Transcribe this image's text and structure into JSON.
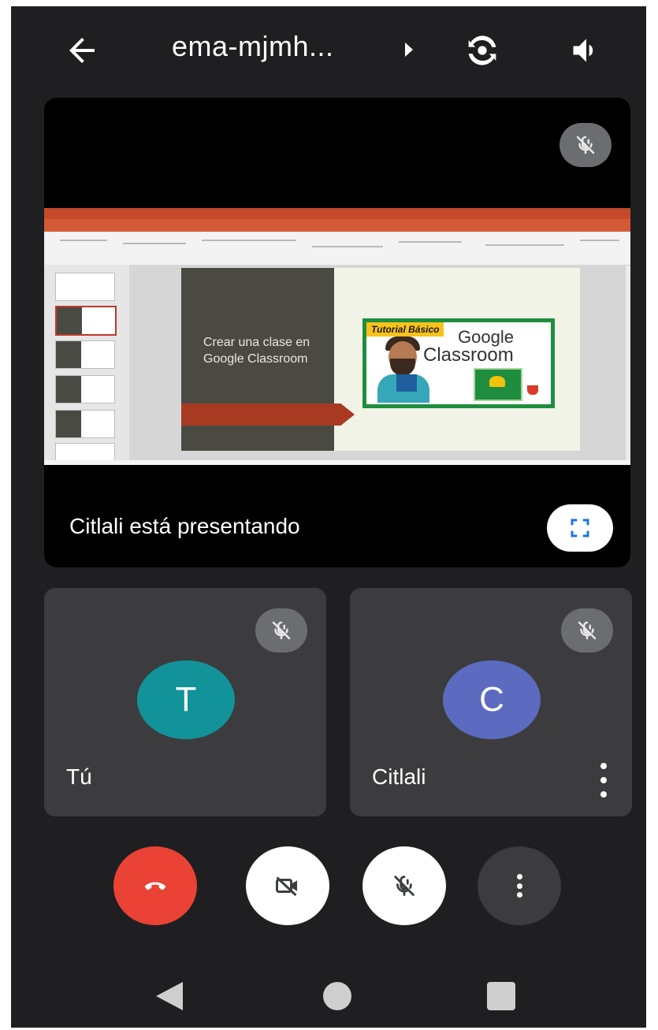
{
  "topbar": {
    "meeting_code": "ema-mjmh...",
    "back_icon": "arrow-left-icon",
    "switch_camera_icon": "switch-camera-icon",
    "audio_icon": "speaker-icon"
  },
  "presentation": {
    "presenter_text": "Citlali está presentando",
    "slide": {
      "title": "Crear una clase en Google Classroom",
      "badge": "Tutorial Básico",
      "logo_line1": "Google",
      "logo_line2": "Classroom"
    },
    "fullscreen_icon": "fullscreen-icon",
    "muted_icon": "mic-off-icon"
  },
  "participants": [
    {
      "name": "Tú",
      "initial": "T",
      "color": "#12939a",
      "muted": true
    },
    {
      "name": "Citlali",
      "initial": "C",
      "color": "#5c6bc0",
      "muted": true
    }
  ],
  "controls": {
    "hangup_icon": "phone-hangup-icon",
    "camera_icon": "camera-off-icon",
    "mic_icon": "mic-off-icon",
    "more_icon": "more-vert-icon"
  },
  "colors": {
    "hangup": "#ea4335",
    "fullscreen_accent": "#1a73e8",
    "muted_badge": "#6b6d70"
  }
}
